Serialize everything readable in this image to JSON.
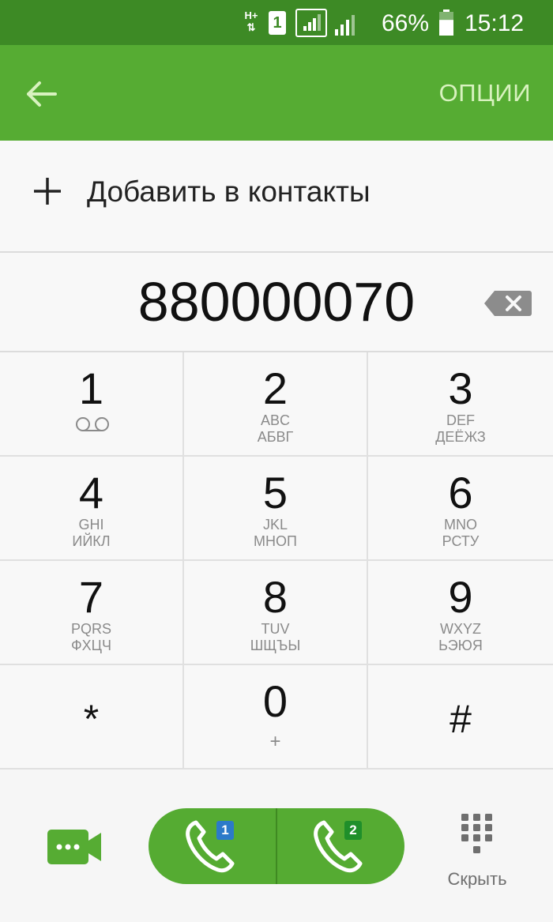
{
  "status_bar": {
    "network_type": "H+",
    "sim_slot": "1",
    "battery_percent": "66%",
    "battery_level": 0.66,
    "time": "15:12"
  },
  "app_bar": {
    "back_icon": "arrow-left-icon",
    "options_label": "ОПЦИИ"
  },
  "add_contact": {
    "icon": "plus-icon",
    "label": "Добавить в контакты"
  },
  "dialer": {
    "number": "880000070",
    "backspace_icon": "backspace-icon"
  },
  "keypad": {
    "keys": [
      {
        "digit": "1",
        "icon": "voicemail-icon"
      },
      {
        "digit": "2",
        "latin": "ABC",
        "cyrillic": "АБВГ"
      },
      {
        "digit": "3",
        "latin": "DEF",
        "cyrillic": "ДЕЁЖЗ"
      },
      {
        "digit": "4",
        "latin": "GHI",
        "cyrillic": "ИЙКЛ"
      },
      {
        "digit": "5",
        "latin": "JKL",
        "cyrillic": "МНОП"
      },
      {
        "digit": "6",
        "latin": "MNO",
        "cyrillic": "РСТУ"
      },
      {
        "digit": "7",
        "latin": "PQRS",
        "cyrillic": "ФХЦЧ"
      },
      {
        "digit": "8",
        "latin": "TUV",
        "cyrillic": "ШЩЪЫ"
      },
      {
        "digit": "9",
        "latin": "WXYZ",
        "cyrillic": "ЬЭЮЯ"
      },
      {
        "symbol": "*"
      },
      {
        "digit": "0",
        "sub": "+"
      },
      {
        "symbol": "#"
      }
    ]
  },
  "bottom_bar": {
    "video_call_icon": "video-call-icon",
    "call_sim1_badge": "1",
    "call_sim2_badge": "2",
    "hide_label": "Скрыть",
    "hide_icon": "keypad-icon"
  },
  "colors": {
    "status_bar": "#3d8a25",
    "app_bar": "#56ac33",
    "accent_text": "#d8f2bf",
    "call_button": "#55ab32",
    "sim1_badge": "#2c7ac9",
    "sim2_badge": "#1f8f2a"
  }
}
